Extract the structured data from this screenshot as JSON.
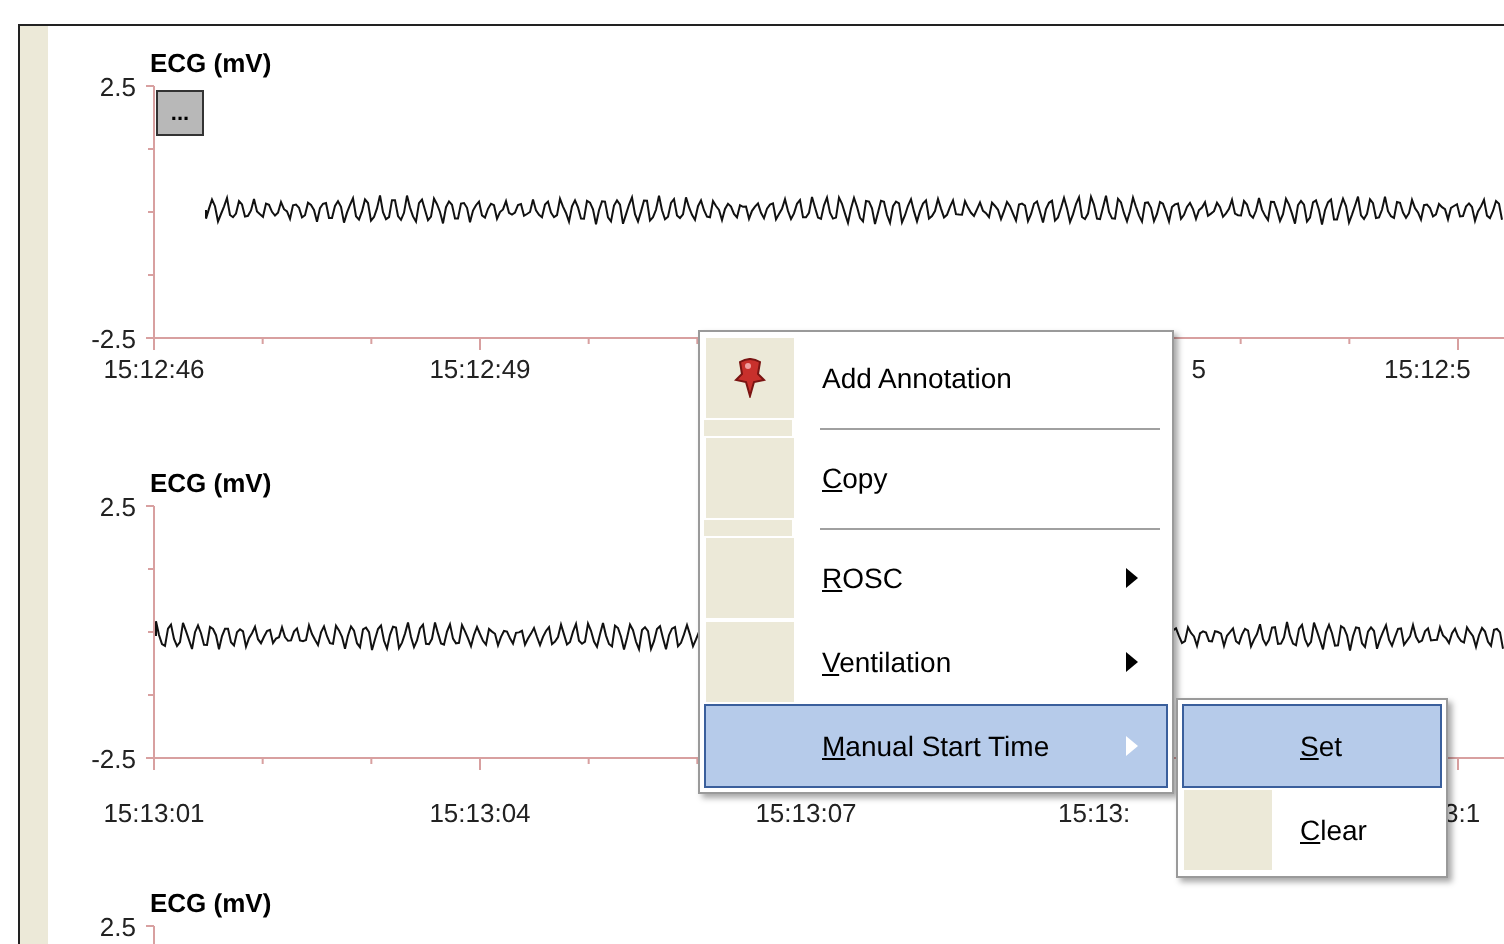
{
  "charts": [
    {
      "title": "ECG (mV)",
      "y_max": "2.5",
      "y_min": "-2.5",
      "more_button": "...",
      "time_labels": [
        {
          "text": "15:12:46",
          "kind": "center"
        },
        {
          "text": "15:12:49",
          "kind": "center"
        },
        {
          "text": "5",
          "kind": "skip-right-part"
        },
        {
          "text": "15:12:5",
          "kind": "left-part"
        }
      ]
    },
    {
      "title": "ECG (mV)",
      "y_max": "2.5",
      "y_min": "-2.5",
      "time_labels": [
        {
          "text": "15:13:01",
          "kind": "center"
        },
        {
          "text": "15:13:04",
          "kind": "center"
        },
        {
          "text": "15:13:07",
          "kind": "center"
        },
        {
          "text": "15:13:",
          "kind": "left-part"
        },
        {
          "text": "3:1",
          "kind": "middle-part"
        }
      ]
    },
    {
      "title": "ECG (mV)",
      "y_max": "2.5"
    }
  ],
  "context_menu": {
    "items": [
      {
        "kind": "pin-item",
        "label": "Add Annotation",
        "mnemonic": false,
        "has_submenu": false,
        "selected": false
      },
      {
        "kind": "separator"
      },
      {
        "kind": "item",
        "label": "Copy",
        "mnemonic": true,
        "has_submenu": false,
        "selected": false
      },
      {
        "kind": "separator"
      },
      {
        "kind": "item",
        "label": "ROSC",
        "mnemonic": true,
        "has_submenu": true,
        "selected": false
      },
      {
        "kind": "item",
        "label": "Ventilation",
        "mnemonic": true,
        "has_submenu": true,
        "selected": false
      },
      {
        "kind": "item",
        "label": "Manual Start Time",
        "mnemonic": true,
        "has_submenu": true,
        "selected": true
      }
    ]
  },
  "submenu": {
    "items": [
      {
        "label": "Set",
        "mnemonic": true,
        "selected": true
      },
      {
        "label": "Clear",
        "mnemonic": true,
        "selected": false
      }
    ]
  }
}
